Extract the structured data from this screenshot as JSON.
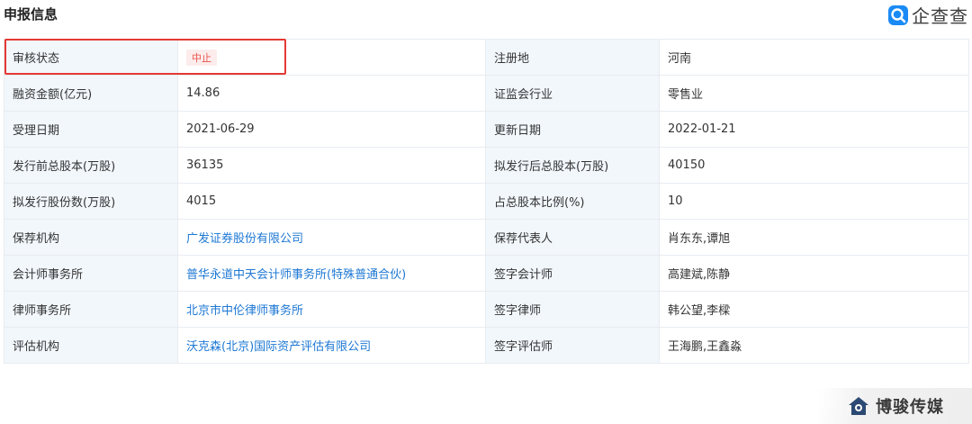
{
  "header": {
    "title": "申报信息",
    "brand": {
      "icon": "qichacha-logo-icon",
      "name": "企查查",
      "color": "#1a8af5"
    }
  },
  "table": {
    "rows": [
      {
        "label_left": "审核状态",
        "value_left": "中止",
        "label_right": "注册地",
        "value_right": "河南"
      },
      {
        "label_left": "融资金额(亿元)",
        "value_left": "14.86",
        "label_right": "证监会行业",
        "value_right": "零售业"
      },
      {
        "label_left": "受理日期",
        "value_left": "2021-06-29",
        "label_right": "更新日期",
        "value_right": "2022-01-21"
      },
      {
        "label_left": "发行前总股本(万股)",
        "value_left": "36135",
        "label_right": "拟发行后总股本(万股)",
        "value_right": "40150"
      },
      {
        "label_left": "拟发行股份数(万股)",
        "value_left": "4015",
        "label_right": "占总股本比例(%)",
        "value_right": "10"
      },
      {
        "label_left": "保荐机构",
        "value_left": "广发证券股份有限公司",
        "label_right": "保荐代表人",
        "value_right": "肖东东,谭旭"
      },
      {
        "label_left": "会计师事务所",
        "value_left": "普华永道中天会计师事务所(特殊普通合伙)",
        "label_right": "签字会计师",
        "value_right": "高建斌,陈静"
      },
      {
        "label_left": "律师事务所",
        "value_left": "北京市中伦律师事务所",
        "label_right": "签字律师",
        "value_right": "韩公望,李樑"
      },
      {
        "label_left": "评估机构",
        "value_left": "沃克森(北京)国际资产评估有限公司",
        "label_right": "签字评估师",
        "value_right": "王海鹏,王鑫淼"
      }
    ]
  },
  "colors": {
    "label_bg": "#f2f7fc",
    "link": "#1e78d4",
    "status_text": "#e8554d",
    "highlight": "#e53935"
  },
  "watermark": {
    "icon": "bojun-logo-icon",
    "text": "博骏传媒"
  }
}
